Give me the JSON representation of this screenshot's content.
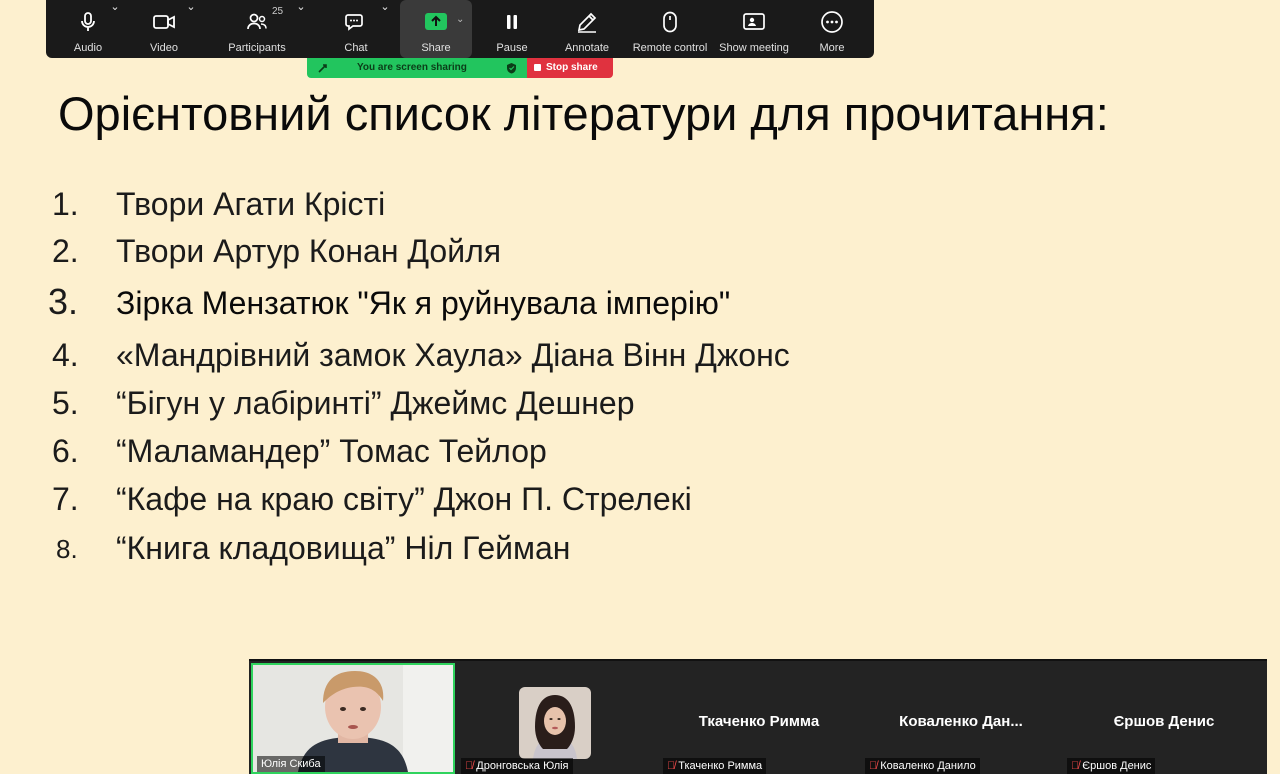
{
  "toolbar": {
    "items": [
      {
        "label": "Audio",
        "icon": "microphone-icon"
      },
      {
        "label": "Video",
        "icon": "video-camera-icon"
      },
      {
        "label": "Participants",
        "icon": "participants-icon",
        "count": "25"
      },
      {
        "label": "Chat",
        "icon": "chat-icon"
      },
      {
        "label": "Share",
        "icon": "share-screen-icon"
      },
      {
        "label": "Pause",
        "icon": "pause-icon"
      },
      {
        "label": "Annotate",
        "icon": "pencil-icon"
      },
      {
        "label": "Remote control",
        "icon": "mouse-icon"
      },
      {
        "label": "Show meeting",
        "icon": "show-meeting-icon"
      },
      {
        "label": "More",
        "icon": "more-dots-icon"
      }
    ]
  },
  "share_banner": {
    "status": "You are screen sharing",
    "stop_label": "Stop share"
  },
  "slide": {
    "title": "Орієнтовний список літератури для прочитання:",
    "items": [
      {
        "num": "1.",
        "text": "Твори Агати Крісті"
      },
      {
        "num": "2.",
        "text": "Твори Артур Конан Дойля"
      },
      {
        "num": "3.",
        "text": "Зірка Мензатюк \"Як я руйнувала імперію\""
      },
      {
        "num": "4.",
        "text": "«Мандрівний замок Хаула»  Діана Вінн Джонс"
      },
      {
        "num": "5.",
        "text": "“Бігун у лабіринті” Джеймс Дешнер"
      },
      {
        "num": "6.",
        "text": "“Маламандер” Томас Тейлор"
      },
      {
        "num": "7.",
        "text": "“Кафе на краю світу” Джон П. Стрелекі"
      },
      {
        "num": "8.",
        "text": "“Книга кладовища” Ніл Гейман"
      }
    ]
  },
  "participants": [
    {
      "label": "Юлія Скиба",
      "has_video": true
    },
    {
      "label": "Дронговська Юлія",
      "muted": true,
      "has_avatar": true
    },
    {
      "label": "Ткаченко Римма",
      "display": "Ткаченко Римма",
      "muted": true
    },
    {
      "label": "Коваленко Данило",
      "display": "Коваленко  Дан...",
      "muted": true
    },
    {
      "label": "Єршов Денис",
      "display": "Єршов Денис",
      "muted": true
    }
  ],
  "colors": {
    "slide_bg": "#fdf0cf",
    "toolbar_bg": "#1a1a1a",
    "share_green": "#22c55e",
    "stop_red": "#e0323f",
    "active_speaker": "#2fd35d"
  }
}
